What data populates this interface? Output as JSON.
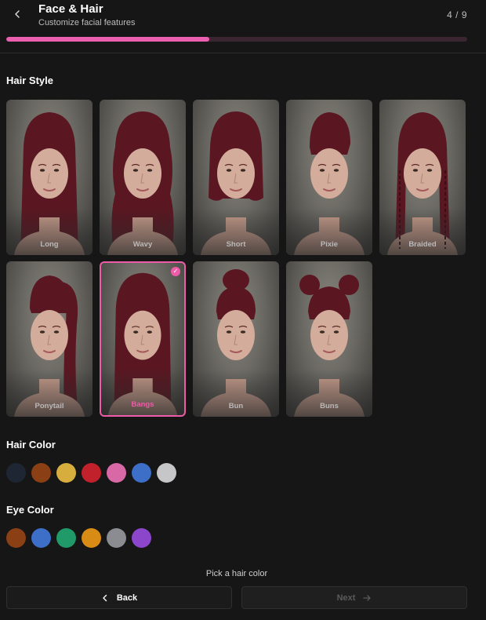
{
  "header": {
    "title": "Face & Hair",
    "subtitle": "Customize facial features",
    "step_label": "4 / 9",
    "progress": 0.44
  },
  "hair_style": {
    "title": "Hair Style",
    "selected": "Bangs",
    "options": [
      {
        "label": "Long"
      },
      {
        "label": "Wavy"
      },
      {
        "label": "Short"
      },
      {
        "label": "Pixie"
      },
      {
        "label": "Braided"
      },
      {
        "label": "Ponytail"
      },
      {
        "label": "Bangs",
        "selected": true
      },
      {
        "label": "Bun"
      },
      {
        "label": "Buns"
      }
    ]
  },
  "hair_color": {
    "title": "Hair Color",
    "swatches": [
      "#1e2633",
      "#8b3f14",
      "#d7ae3e",
      "#c1212a",
      "#d868a6",
      "#3d6ec8",
      "#c6c6c8"
    ]
  },
  "eye_color": {
    "title": "Eye Color",
    "swatches": [
      "#8b3f14",
      "#3d6ec8",
      "#1f9a68",
      "#d88c16",
      "#8a8c92",
      "#8c46cc"
    ]
  },
  "hint": "Pick a hair color",
  "footer": {
    "back_label": "Back",
    "next_label": "Next"
  },
  "theme": {
    "accent": "#ee5ba9",
    "hair": "#5a1722"
  }
}
